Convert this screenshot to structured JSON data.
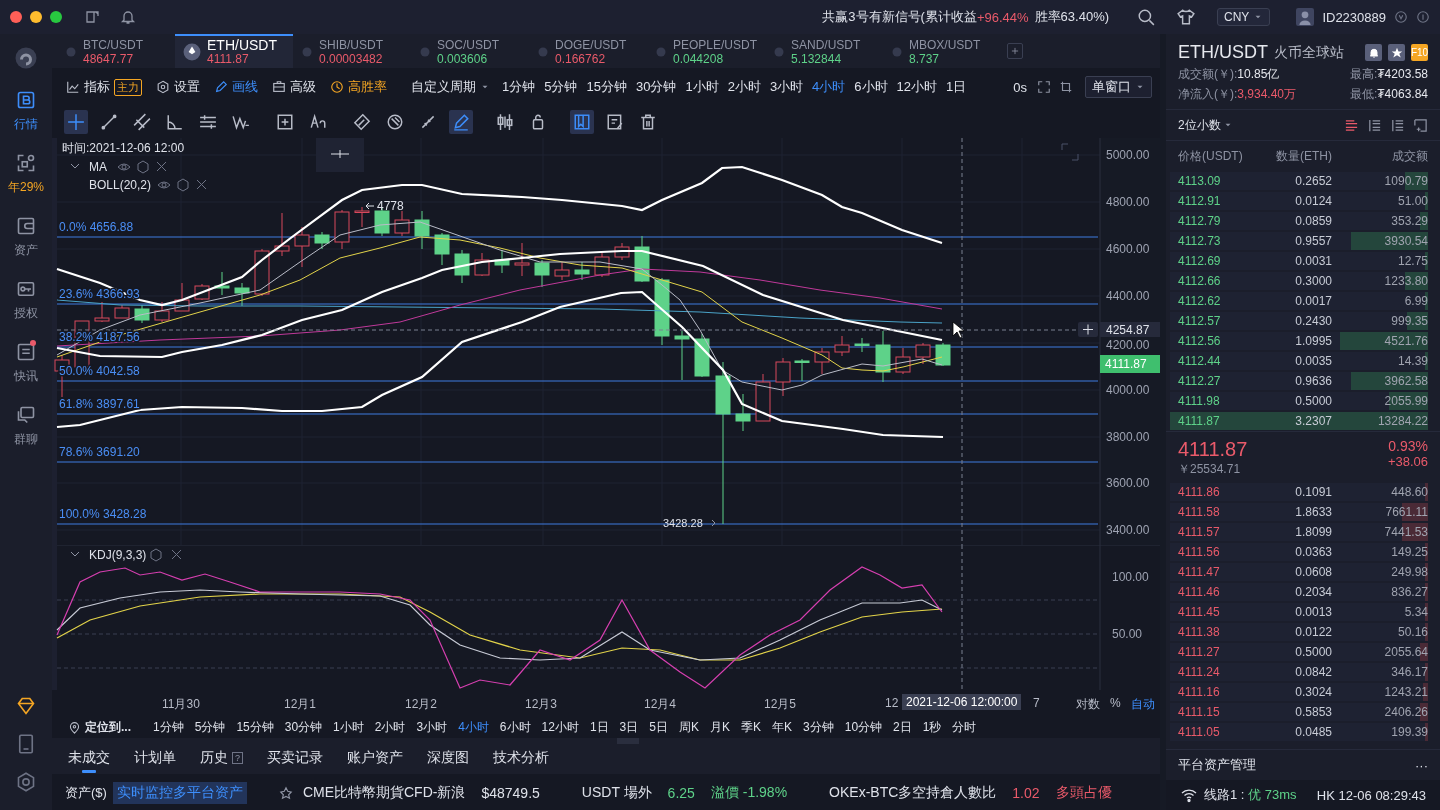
{
  "top_bar": {
    "signal_prefix": "共赢3号有新信号(累计收益",
    "signal_gain": "+96.44%",
    "signal_suffix": "胜率63.40%)",
    "currency": "CNY",
    "user_id": "ID2230889"
  },
  "sidebar": {
    "items": [
      {
        "label": "行情",
        "kind": "market",
        "selected": true,
        "badge": false
      },
      {
        "label": "年29%",
        "kind": "strategy",
        "selected": false,
        "badge": false
      },
      {
        "label": "资产",
        "kind": "wallet",
        "selected": false,
        "badge": false
      },
      {
        "label": "授权",
        "kind": "key",
        "selected": false,
        "badge": false
      },
      {
        "label": "快讯",
        "kind": "news",
        "selected": false,
        "badge": true
      },
      {
        "label": "群聊",
        "kind": "chat",
        "selected": false,
        "badge": false
      }
    ]
  },
  "symbol_tabs": [
    {
      "symbol": "BTC/USDT",
      "price": "48647.77",
      "color": "#ea5a6a",
      "selected": false
    },
    {
      "symbol": "ETH/USDT",
      "price": "4111.87",
      "color": "#ea5a6a",
      "selected": true
    },
    {
      "symbol": "SHIB/USDT",
      "price": "0.00003482",
      "color": "#ea5a6a",
      "selected": false
    },
    {
      "symbol": "SOC/USDT",
      "price": "0.003606",
      "color": "#5ed289",
      "selected": false
    },
    {
      "symbol": "DOGE/USDT",
      "price": "0.166762",
      "color": "#ea5a6a",
      "selected": false
    },
    {
      "symbol": "PEOPLE/USDT",
      "price": "0.044208",
      "color": "#5ed289",
      "selected": false
    },
    {
      "symbol": "SAND/USDT",
      "price": "5.132844",
      "color": "#5ed289",
      "selected": false
    },
    {
      "symbol": "MBOX/USDT",
      "price": "8.737",
      "color": "#5ed289",
      "selected": false
    }
  ],
  "toolbar": {
    "indicator": "指标",
    "indicator_badge": "主力",
    "settings": "设置",
    "draw": "画线",
    "advanced": "高级",
    "win_rate": "高胜率",
    "custom_period": "自定义周期",
    "periods": [
      {
        "label": "1分钟",
        "selected": false
      },
      {
        "label": "5分钟",
        "selected": false
      },
      {
        "label": "15分钟",
        "selected": false
      },
      {
        "label": "30分钟",
        "selected": false
      },
      {
        "label": "1小时",
        "selected": false
      },
      {
        "label": "2小时",
        "selected": false
      },
      {
        "label": "3小时",
        "selected": false
      },
      {
        "label": "4小时",
        "selected": true
      },
      {
        "label": "6小时",
        "selected": false
      },
      {
        "label": "12小时",
        "selected": false
      },
      {
        "label": "1日",
        "selected": false
      }
    ],
    "timer": "0s",
    "window_mode": "单窗口",
    "tools": [
      {
        "kind": "crosshair",
        "active": true
      },
      {
        "kind": "line",
        "active": false
      },
      {
        "kind": "parallel",
        "active": false
      },
      {
        "kind": "angle",
        "active": false
      },
      {
        "kind": "lines",
        "active": false
      },
      {
        "kind": "wave",
        "active": false
      },
      {
        "kind": "note",
        "active": false
      },
      {
        "kind": "text",
        "active": false
      },
      {
        "kind": "eraser",
        "active": false
      },
      {
        "kind": "magnet",
        "active": false
      },
      {
        "kind": "ruler",
        "active": false
      },
      {
        "kind": "pen",
        "active": true
      },
      {
        "kind": "candles",
        "active": false
      },
      {
        "kind": "lock",
        "active": false
      },
      {
        "kind": "bookmark",
        "active": true
      },
      {
        "kind": "edit",
        "active": false
      },
      {
        "kind": "trash",
        "active": false
      }
    ]
  },
  "price_chart": {
    "time_label": "时间:2021-12-06 12:00",
    "indicators": [
      {
        "name": "MA",
        "collapsible": true
      },
      {
        "name": "BOLL(20,2)",
        "collapsible": false
      }
    ],
    "fib_levels": [
      "0.0% 4656.88",
      "23.6% 4366.93",
      "38.2% 4187.56",
      "50.0% 4042.58",
      "61.8% 3897.61",
      "78.6% 3691.20",
      "100.0% 3428.28"
    ],
    "y_ticks": [
      "5000.00",
      "4800.00",
      "4600.00",
      "4400.00",
      "4200.00",
      "4000.00",
      "3800.00",
      "3600.00",
      "3400.00"
    ],
    "high_marker": "4778",
    "low_marker": "3428.28",
    "crosshair_price": "4254.87",
    "last_price": "4111.87"
  },
  "kdj": {
    "name": "KDJ(9,3,3)",
    "y_ticks": [
      "100.00",
      "50.00"
    ]
  },
  "x_axis": {
    "labels": [
      "11月30",
      "12月1",
      "12月2",
      "12月3",
      "12月4",
      "12月5",
      "12"
    ],
    "crosshair_time": "2021-12-06 12:00:00",
    "trailing": "7",
    "scale_log": "对数",
    "scale_pct": "%",
    "auto": "自动"
  },
  "period_bar": {
    "locate": "定位到...",
    "periods": [
      {
        "label": "1分钟",
        "selected": false
      },
      {
        "label": "5分钟",
        "selected": false
      },
      {
        "label": "15分钟",
        "selected": false
      },
      {
        "label": "30分钟",
        "selected": false
      },
      {
        "label": "1小时",
        "selected": false
      },
      {
        "label": "2小时",
        "selected": false
      },
      {
        "label": "3小时",
        "selected": false
      },
      {
        "label": "4小时",
        "selected": true
      },
      {
        "label": "6小时",
        "selected": false
      },
      {
        "label": "12小时",
        "selected": false
      },
      {
        "label": "1日",
        "selected": false
      },
      {
        "label": "3日",
        "selected": false
      },
      {
        "label": "5日",
        "selected": false
      },
      {
        "label": "周K",
        "selected": false
      },
      {
        "label": "月K",
        "selected": false
      },
      {
        "label": "季K",
        "selected": false
      },
      {
        "label": "年K",
        "selected": false
      },
      {
        "label": "3分钟",
        "selected": false
      },
      {
        "label": "10分钟",
        "selected": false
      },
      {
        "label": "2日",
        "selected": false
      },
      {
        "label": "1秒",
        "selected": false
      },
      {
        "label": "分时",
        "selected": false
      }
    ]
  },
  "bottom_tabs": [
    {
      "label": "未成交",
      "selected": true
    },
    {
      "label": "计划单",
      "selected": false
    },
    {
      "label": "历史",
      "selected": false,
      "hint": "?"
    },
    {
      "label": "买卖记录",
      "selected": false
    },
    {
      "label": "账户资产",
      "selected": false
    },
    {
      "label": "深度图",
      "selected": false
    },
    {
      "label": "技术分析",
      "selected": false
    }
  ],
  "ticker_bar": {
    "assets_label": "资产($)",
    "assets_link": "实时监控多平台资产",
    "items": [
      {
        "parts": [
          {
            "text": "CME比特幣期貨CFD-新浪"
          },
          {
            "text": "$48749.5"
          }
        ]
      },
      {
        "parts": [
          {
            "text": "USDT 場外"
          },
          {
            "text": "6.25",
            "color": "#5ed289"
          },
          {
            "text": "溢價 -1.98%",
            "color": "#5ed289"
          }
        ]
      },
      {
        "parts": [
          {
            "text": "OKEx-BTC多空持倉人數比"
          },
          {
            "text": "1.02",
            "color": "#ea5a6a"
          },
          {
            "text": "多頭占優",
            "color": "#ea5a6a"
          }
        ]
      }
    ]
  },
  "quote": {
    "symbol": "ETH/USDT",
    "exchange": "火币全球站",
    "badge": "F10",
    "turnover_label": "成交额(￥):",
    "turnover": "10.85亿",
    "inflow_label": "净流入(￥):",
    "inflow": "3,934.40万",
    "high_label": "最高:",
    "high": "₮4203.58",
    "low_label": "最低:",
    "low": "₮4063.84"
  },
  "order_book": {
    "precision": "2位小数",
    "columns": [
      "价格(USDT)",
      "数量(ETH)",
      "成交额"
    ],
    "rows_above": [
      {
        "price": "4113.09",
        "amount": "0.2652",
        "total": "1090.79",
        "level": 0.09
      },
      {
        "price": "4112.91",
        "amount": "0.0124",
        "total": "51.00",
        "level": 0.01
      },
      {
        "price": "4112.79",
        "amount": "0.0859",
        "total": "353.29",
        "level": 0.03
      },
      {
        "price": "4112.73",
        "amount": "0.9557",
        "total": "3930.54",
        "level": 0.3
      },
      {
        "price": "4112.69",
        "amount": "0.0031",
        "total": "12.75",
        "level": 0.01
      },
      {
        "price": "4112.66",
        "amount": "0.3000",
        "total": "1233.80",
        "level": 0.09
      },
      {
        "price": "4112.62",
        "amount": "0.0017",
        "total": "6.99",
        "level": 0.01
      },
      {
        "price": "4112.57",
        "amount": "0.2430",
        "total": "999.35",
        "level": 0.08
      },
      {
        "price": "4112.56",
        "amount": "1.0995",
        "total": "4521.76",
        "level": 0.34
      },
      {
        "price": "4112.44",
        "amount": "0.0035",
        "total": "14.39",
        "level": 0.01
      },
      {
        "price": "4112.27",
        "amount": "0.9636",
        "total": "3962.58",
        "level": 0.3
      },
      {
        "price": "4111.98",
        "amount": "0.5000",
        "total": "2055.99",
        "level": 0.15
      },
      {
        "price": "4111.87",
        "amount": "3.2307",
        "total": "13284.22",
        "level": 1
      }
    ],
    "last_price": "4111.87",
    "last_cny": "￥25534.71",
    "change_pct": "0.93%",
    "change": "+38.06",
    "rows_below": [
      {
        "price": "4111.86",
        "amount": "0.1091",
        "total": "448.60",
        "level": 0.01
      },
      {
        "price": "4111.58",
        "amount": "1.8633",
        "total": "7661.11",
        "level": 0.1
      },
      {
        "price": "4111.57",
        "amount": "1.8099",
        "total": "7441.53",
        "level": 0.1
      },
      {
        "price": "4111.56",
        "amount": "0.0363",
        "total": "149.25",
        "level": 0.01
      },
      {
        "price": "4111.47",
        "amount": "0.0608",
        "total": "249.98",
        "level": 0.01
      },
      {
        "price": "4111.46",
        "amount": "0.2034",
        "total": "836.27",
        "level": 0.01
      },
      {
        "price": "4111.45",
        "amount": "0.0013",
        "total": "5.34",
        "level": 0.01
      },
      {
        "price": "4111.38",
        "amount": "0.0122",
        "total": "50.16",
        "level": 0.01
      },
      {
        "price": "4111.27",
        "amount": "0.5000",
        "total": "2055.64",
        "level": 0.03
      },
      {
        "price": "4111.24",
        "amount": "0.0842",
        "total": "346.17",
        "level": 0.01
      },
      {
        "price": "4111.16",
        "amount": "0.3024",
        "total": "1243.21",
        "level": 0.02
      },
      {
        "price": "4111.15",
        "amount": "0.5853",
        "total": "2406.26",
        "level": 0.03
      },
      {
        "price": "4111.05",
        "amount": "0.0485",
        "total": "199.39",
        "level": 0.01
      }
    ]
  },
  "asset_panel": {
    "title": "平台资产管理",
    "more": "···"
  },
  "status": {
    "line_label": "线路1 : ",
    "quality": "优 73ms",
    "clock": "HK 12-06 08:29:43"
  }
}
